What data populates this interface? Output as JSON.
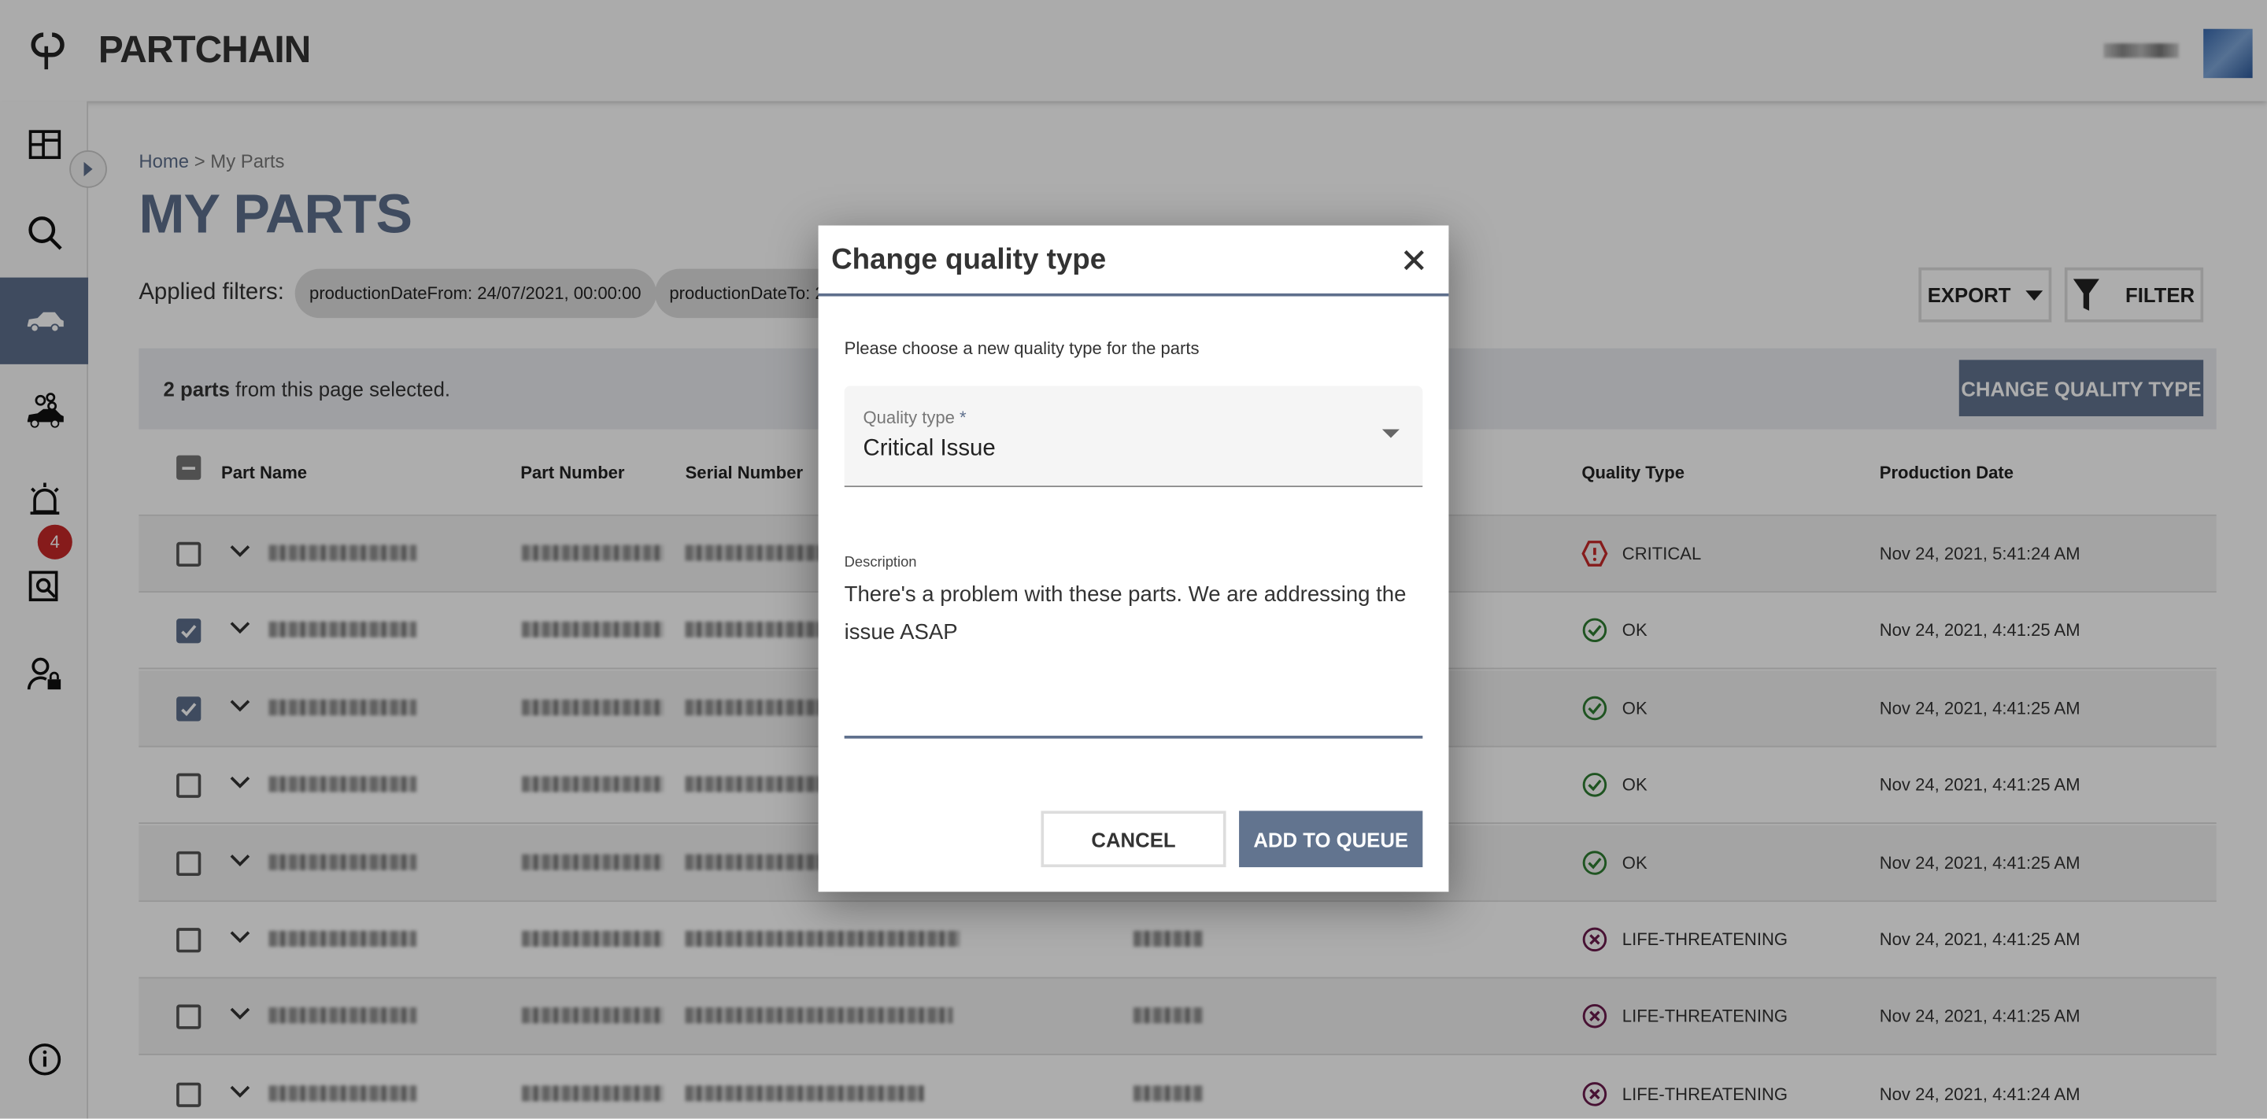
{
  "app": {
    "brand": "PARTCHAIN",
    "accent": "#5e6f8c"
  },
  "sidebar": {
    "items": [
      {
        "icon": "dashboard-icon"
      },
      {
        "icon": "search-icon"
      },
      {
        "icon": "car-icon",
        "active": true
      },
      {
        "icon": "car-parts-icon"
      },
      {
        "icon": "alarm-icon"
      },
      {
        "icon": "investigation-icon",
        "badge": "4"
      },
      {
        "icon": "user-lock-icon"
      },
      {
        "icon": "info-icon"
      }
    ]
  },
  "breadcrumb": {
    "home": "Home",
    "separator": ">",
    "current": "My Parts"
  },
  "page": {
    "title": "MY PARTS"
  },
  "filters": {
    "label": "Applied filters:",
    "chips": [
      "productionDateFrom: 24/07/2021, 00:00:00",
      "productionDateTo: 2"
    ]
  },
  "toolbar": {
    "export": "EXPORT",
    "filter": "FILTER"
  },
  "selection": {
    "count": "2 parts",
    "suffix": " from this page selected.",
    "change_button": "CHANGE QUALITY TYPE"
  },
  "table": {
    "headers": {
      "part_name": "Part Name",
      "part_number": "Part Number",
      "serial_number": "Serial Number",
      "quality_type": "Quality Type",
      "production_date": "Production Date"
    },
    "rows": [
      {
        "checked": false,
        "quality": "CRITICAL",
        "quality_icon": "critical-icon",
        "date": "Nov 24, 2021, 5:41:24 AM"
      },
      {
        "checked": true,
        "quality": "OK",
        "quality_icon": "ok-icon",
        "date": "Nov 24, 2021, 4:41:25 AM"
      },
      {
        "checked": true,
        "quality": "OK",
        "quality_icon": "ok-icon",
        "date": "Nov 24, 2021, 4:41:25 AM"
      },
      {
        "checked": false,
        "quality": "OK",
        "quality_icon": "ok-icon",
        "date": "Nov 24, 2021, 4:41:25 AM"
      },
      {
        "checked": false,
        "quality": "OK",
        "quality_icon": "ok-icon",
        "date": "Nov 24, 2021, 4:41:25 AM"
      },
      {
        "checked": false,
        "quality": "LIFE-THREATENING",
        "quality_icon": "life-threatening-icon",
        "date": "Nov 24, 2021, 4:41:25 AM"
      },
      {
        "checked": false,
        "quality": "LIFE-THREATENING",
        "quality_icon": "life-threatening-icon",
        "date": "Nov 24, 2021, 4:41:25 AM"
      },
      {
        "checked": false,
        "quality": "LIFE-THREATENING",
        "quality_icon": "life-threatening-icon",
        "date": "Nov 24, 2021, 4:41:24 AM"
      }
    ]
  },
  "dialog": {
    "title": "Change quality type",
    "intro": "Please choose a new quality type for the parts",
    "quality_label": "Quality type",
    "required_mark": " *",
    "quality_value": "Critical Issue",
    "description_label": "Description",
    "description_value": "There's a problem with these parts. We are addressing the issue ASAP",
    "cancel": "CANCEL",
    "submit": "ADD TO QUEUE"
  },
  "colors": {
    "critical": "#c62828",
    "ok": "#2e7d32",
    "life_threatening": "#6a1b4d"
  }
}
